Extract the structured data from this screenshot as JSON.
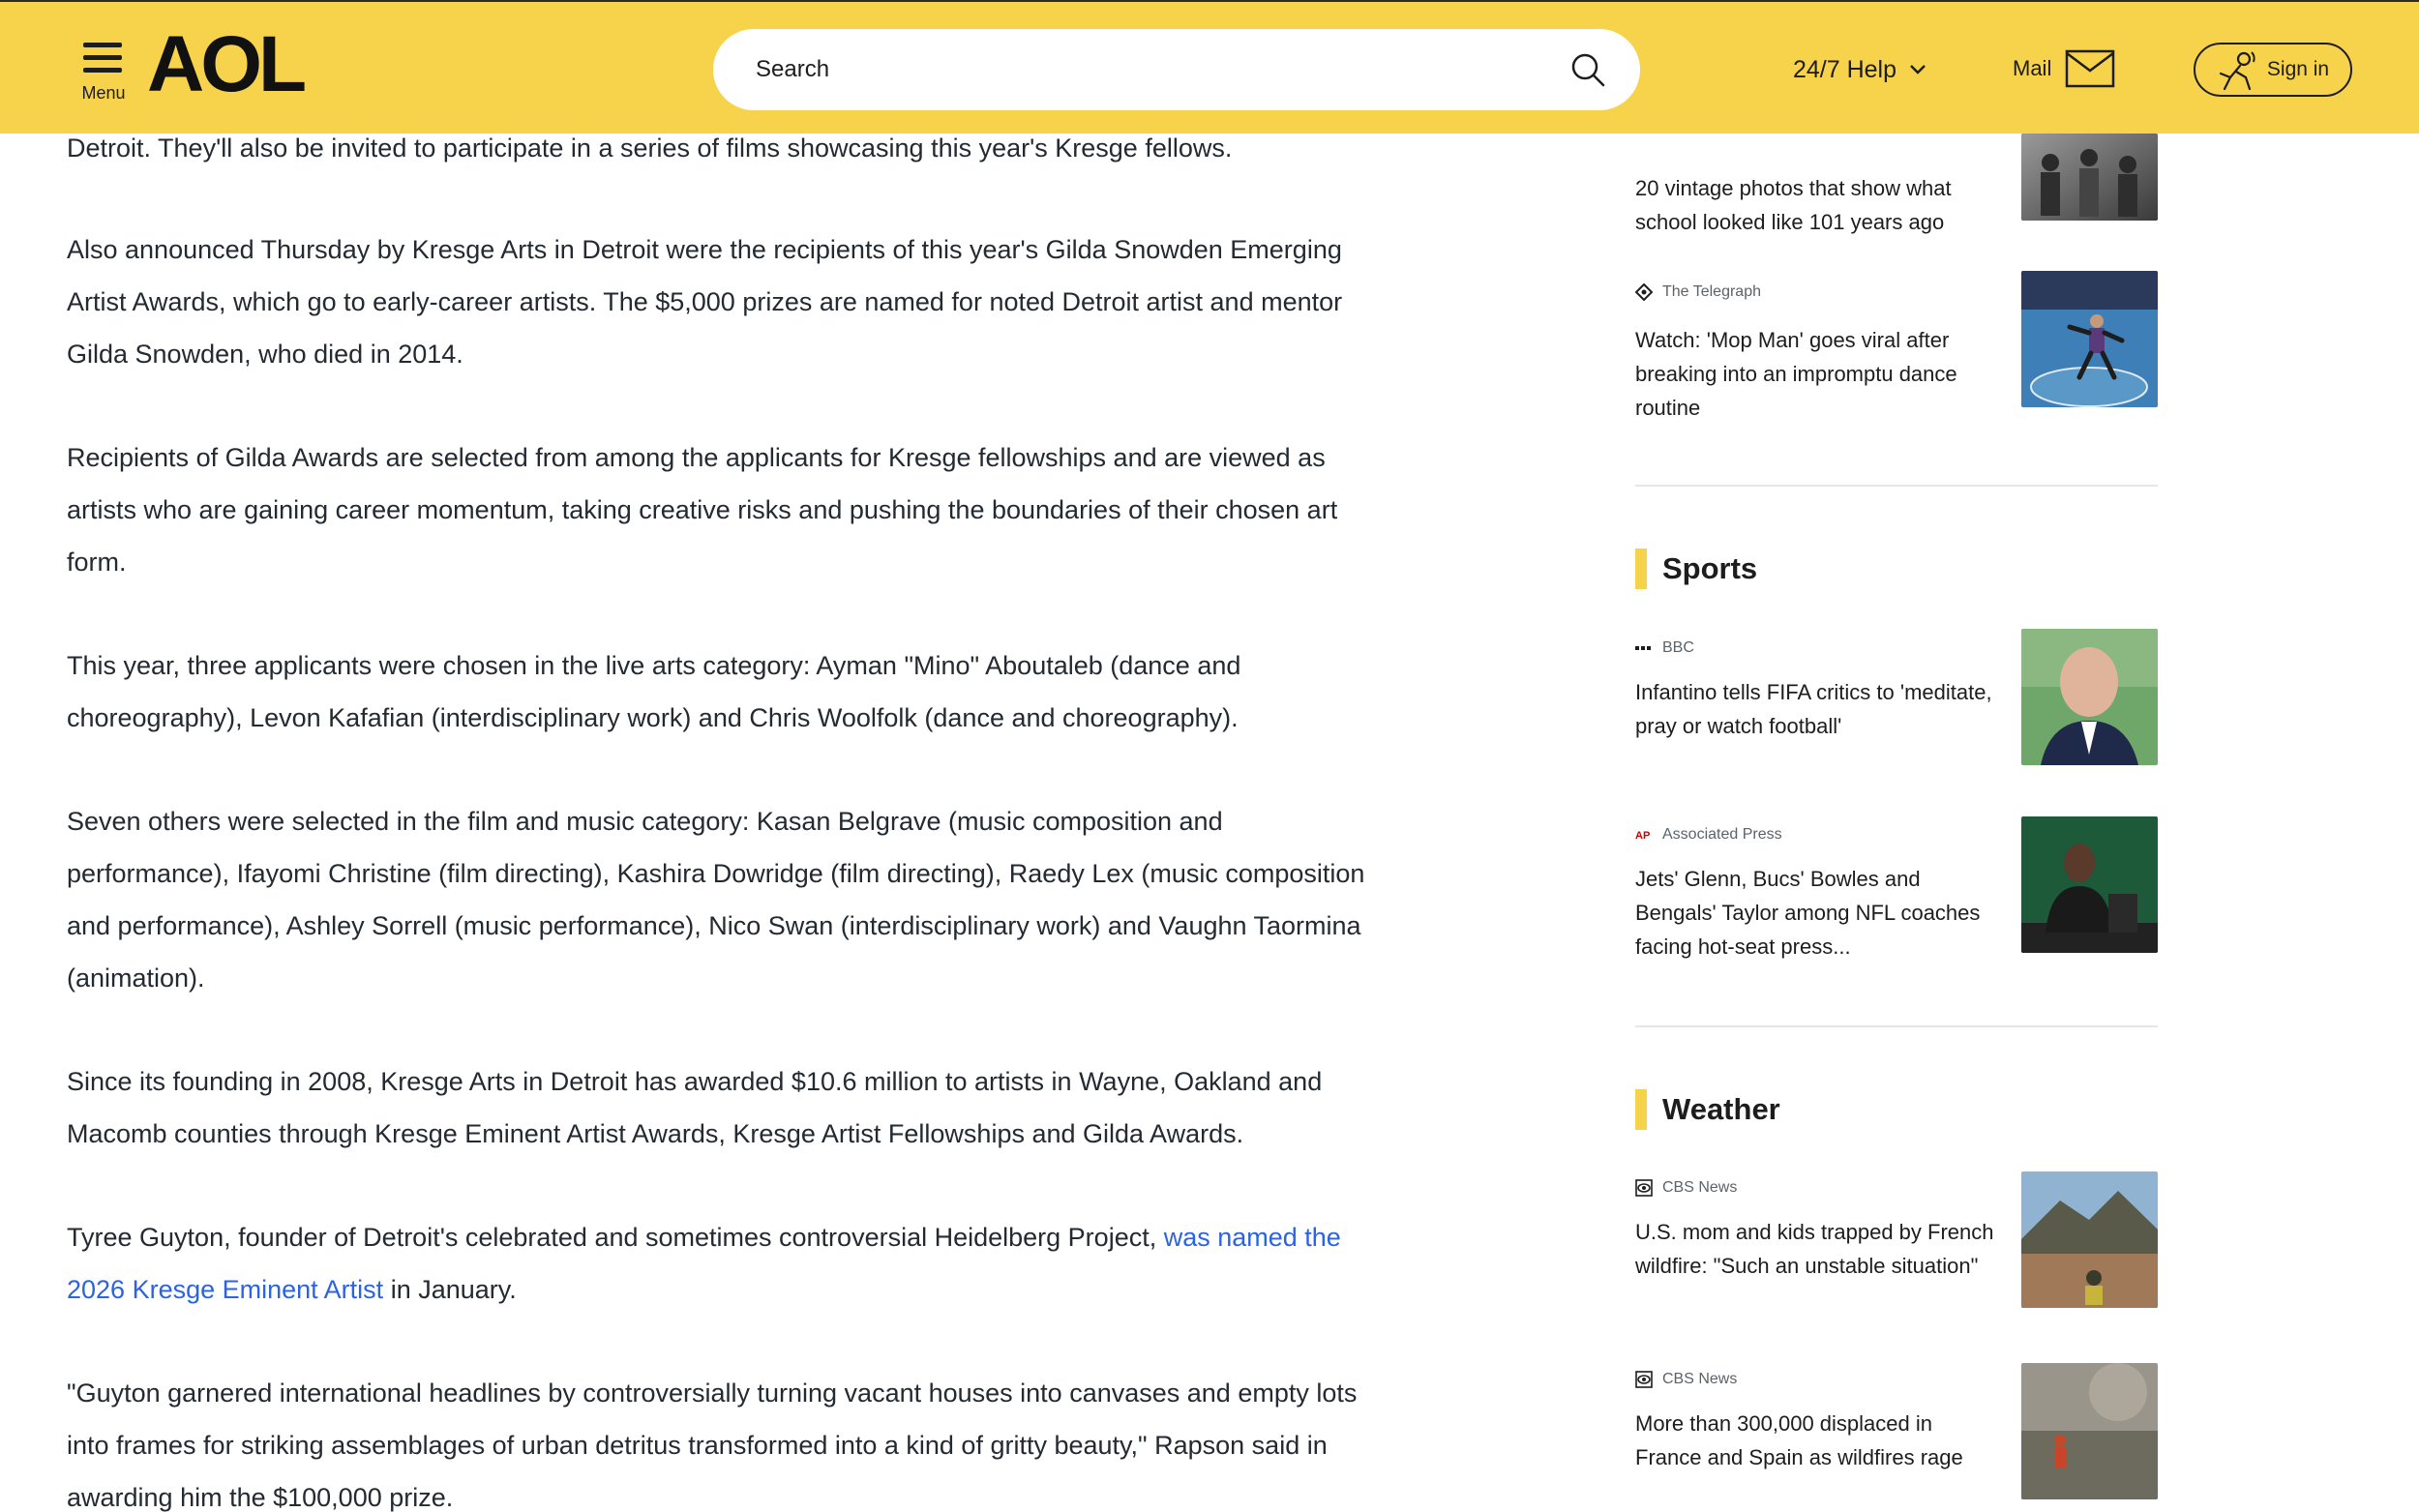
{
  "header": {
    "menu_label": "Menu",
    "logo_text": "AOL",
    "search_placeholder": "Search",
    "help_label": "24/7 Help",
    "mail_label": "Mail",
    "signin_label": "Sign in",
    "accent_color": "#f7d34c"
  },
  "article": {
    "paragraphs": [
      "Detroit. They'll also be invited to participate in a series of films showcasing this year's Kresge fellows.",
      "Also announced Thursday by Kresge Arts in Detroit were the recipients of this year's Gilda Snowden Emerging Artist Awards, which go to early-career artists. The $5,000 prizes are named for noted Detroit artist and mentor Gilda Snowden, who died in 2014.",
      "Recipients of Gilda Awards are selected from among the applicants for Kresge fellowships and are viewed as artists who are gaining career momentum, taking creative risks and pushing the boundaries of their chosen art form.",
      "This year, three applicants were chosen in the live arts category: Ayman \"Mino\" Aboutaleb (dance and choreography), Levon Kafafian (interdisciplinary work) and Chris Woolfolk (dance and choreography).",
      "Seven others were selected in the film and music category: Kasan Belgrave (music composition and performance), Ifayomi Christine (film directing), Kashira Dowridge (film directing), Raedy Lex (music composition and performance), Ashley Sorrell (music performance), Nico Swan (interdisciplinary work) and Vaughn Taormina (animation).",
      "Since its founding in 2008, Kresge Arts in Detroit has awarded $10.6 million to artists in Wayne, Oakland and Macomb counties through Kresge Eminent Artist Awards, Kresge Artist Fellowships and Gilda Awards."
    ],
    "guyton_before": "Tyree Guyton, founder of Detroit's celebrated and sometimes controversial Heidelberg Project, ",
    "guyton_link": "was named the 2026 Kresge Eminent Artist",
    "guyton_after": " in January.",
    "quote": "\"Guyton garnered international headlines by controversially turning vacant houses into canvases and empty lots into frames for striking assemblages of urban detritus transformed into a kind of gritty beauty,\" Rapson said in awarding him the $100,000 prize.",
    "link_color": "#2b63e3"
  },
  "sidebar": {
    "top_stories": [
      {
        "source": "",
        "headline": "20 vintage photos that show what school looked like 101 years ago",
        "thumb_icon": "vintage-school-photo"
      },
      {
        "source": "The Telegraph",
        "headline": "Watch: 'Mop Man' goes viral after breaking into an impromptu dance routine",
        "thumb_icon": "mop-man-photo"
      }
    ],
    "sports": {
      "title": "Sports",
      "items": [
        {
          "source": "BBC",
          "headline": "Infantino tells FIFA critics to 'meditate, pray or watch football'",
          "thumb_icon": "infantino-photo"
        },
        {
          "source": "Associated Press",
          "headline": "Jets' Glenn, Bucs' Bowles and Bengals' Taylor among NFL coaches facing hot-seat press...",
          "thumb_icon": "jets-coach-photo"
        }
      ]
    },
    "weather": {
      "title": "Weather",
      "items": [
        {
          "source": "CBS News",
          "headline": "U.S. mom and kids trapped by French wildfire: \"Such an unstable situation\"",
          "thumb_icon": "wildfire-hill-photo"
        },
        {
          "source": "CBS News",
          "headline": "More than 300,000 displaced in France and Spain as wildfires rage",
          "thumb_icon": "firefighter-photo"
        }
      ]
    }
  }
}
